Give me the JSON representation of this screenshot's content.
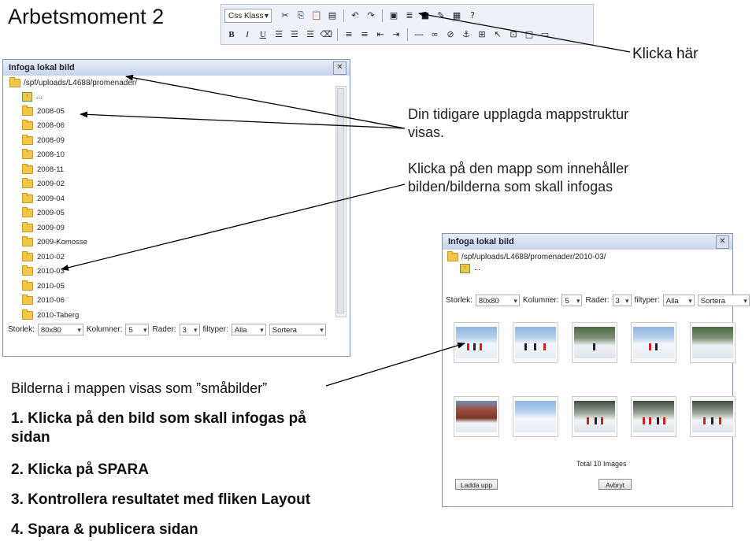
{
  "heading": "Arbetsmoment 2",
  "toolbar": {
    "css_select": "Css Klass",
    "bold": "B",
    "italic": "I",
    "underline": "U",
    "icons_row1": [
      "cut-icon",
      "copy-icon",
      "paste-icon",
      "paste-text-icon",
      "undo-icon",
      "redo-icon",
      "insert-image-icon",
      "insert-file-icon",
      "insert-flash-icon",
      "edit-icon",
      "pdf-icon",
      "help-icon"
    ],
    "icons_row2": [
      "align-left-icon",
      "align-center-icon",
      "align-right-icon",
      "clear-format-icon",
      "ordered-list-icon",
      "unordered-list-icon",
      "outdent-icon",
      "indent-icon",
      "horizontal-rule-icon",
      "link-icon",
      "unlink-icon",
      "anchor-icon",
      "table-icon",
      "select-icon",
      "template-icon",
      "new-page-icon",
      "preview-icon"
    ]
  },
  "callout_click_here": "Klicka här",
  "dialog_left": {
    "title": "Infoga lokal bild",
    "path": "/spf/uploads/L4688/promenader/",
    "up_label": "...",
    "folders": [
      "2008-05",
      "2008-06",
      "2008-09",
      "2008-10",
      "2008-11",
      "2009-02",
      "2009-04",
      "2009-05",
      "2009-09",
      "2009-Komosse",
      "2010-02",
      "2010-03",
      "2010-05",
      "2010-06",
      "2010-Taberg"
    ],
    "options": {
      "size_label": "Storlek:",
      "size_value": "80x80",
      "columns_label": "Kolumner:",
      "columns_value": "5",
      "rows_label": "Rader:",
      "rows_value": "3",
      "filetype_label": "filtyper:",
      "filetype_value": "Alla",
      "sort_value": "Sortera"
    }
  },
  "dialog_right": {
    "title": "Infoga lokal bild",
    "path": "/spf/uploads/L4688/promenader/2010-03/",
    "up_label": "...",
    "options": {
      "size_label": "Storlek:",
      "size_value": "80x80",
      "columns_label": "Kolumner:",
      "columns_value": "5",
      "rows_label": "Rader:",
      "rows_value": "3",
      "filetype_label": "filtyper:",
      "filetype_value": "Alla",
      "sort_value": "Sortera"
    },
    "total": "Total 10 Images",
    "upload_button": "Ladda upp",
    "cancel_button": "Avbryt"
  },
  "notes": {
    "structure_line1": "Din tidigare upplagda mappstruktur",
    "structure_line2": "visas.",
    "click_folder_line1": "Klicka på den mapp som innehåller",
    "click_folder_line2": "bilden/bilderna som skall infogas",
    "thumbnails_line": "Bilderna i mappen visas som ”småbilder”"
  },
  "steps": {
    "s1_line1": "1. Klicka på den bild som skall infogas på",
    "s1_line2": "sidan",
    "s2": "2. Klicka på SPARA",
    "s3": "3. Kontrollera resultatet med fliken Layout",
    "s4": "4. Spara & publicera sidan"
  },
  "colors": {
    "dialog_border": "#7f95b8",
    "folder": "#f2c649",
    "toolbar_bg": "#eef2f8"
  }
}
